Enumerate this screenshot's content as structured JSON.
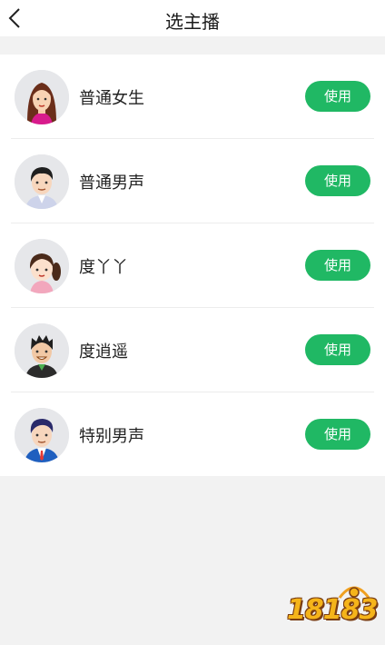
{
  "header": {
    "title": "选主播",
    "back_icon": "chevron-left-icon"
  },
  "anchors": [
    {
      "name": "普通女生",
      "button": "使用",
      "avatar": "female-long-hair-avatar"
    },
    {
      "name": "普通男声",
      "button": "使用",
      "avatar": "male-suit-avatar"
    },
    {
      "name": "度丫丫",
      "button": "使用",
      "avatar": "girl-ponytail-avatar"
    },
    {
      "name": "度逍遥",
      "button": "使用",
      "avatar": "male-spiky-hair-avatar"
    },
    {
      "name": "特别男声",
      "button": "使用",
      "avatar": "male-blue-suit-avatar"
    }
  ],
  "watermark": {
    "text": "18183"
  },
  "colors": {
    "accent": "#20b864",
    "background": "#f2f2f2"
  }
}
